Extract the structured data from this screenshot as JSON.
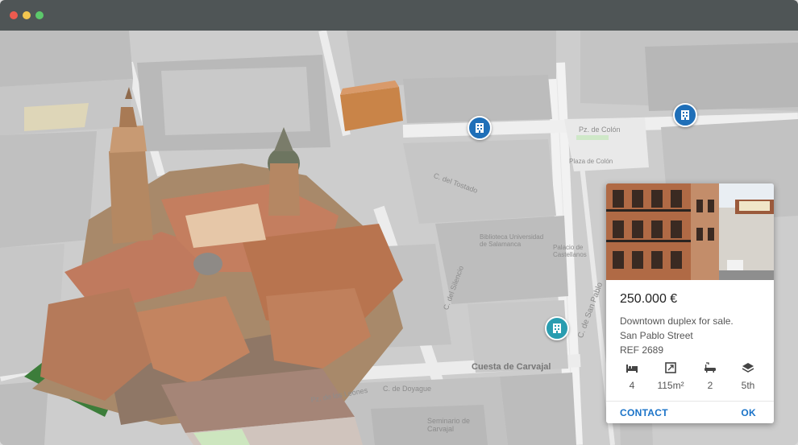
{
  "map": {
    "labels": {
      "plaza_colon": "Pz. de Colón",
      "plaza_colon_small": "Plaza de Colón",
      "calle_tostado": "C. del Tostado",
      "c_san_pablo": "C. de San Pablo",
      "cuesta_carvajal": "Cuesta de Carvajal",
      "pz_leones": "Pz. de los Leones",
      "c_doyague": "C. de Doyague",
      "seminario": "Seminario de Carvajal",
      "biblioteca": "Biblioteca Universidad de Salamanca",
      "palacio": "Palacio de Castellanos",
      "c_silencio": "C. del Silencio"
    },
    "pins": [
      {
        "name": "property-pin-1",
        "type": "building-icon"
      },
      {
        "name": "property-pin-2",
        "type": "building-icon"
      },
      {
        "name": "property-pin-3",
        "type": "building-icon"
      }
    ]
  },
  "listing": {
    "price": "250.000 €",
    "description": "Downtown duplex for sale.",
    "street": "San Pablo Street",
    "ref": "REF 2689",
    "stats": {
      "bedrooms": "4",
      "area": "115m²",
      "bathrooms": "2",
      "floor": "5th"
    },
    "contact_label": "CONTACT",
    "ok_label": "OK"
  },
  "colors": {
    "titlebar": "#4f5556",
    "pin_blue": "#1f6fb8",
    "pin_teal": "#2a9db0",
    "accent": "#1a73c8"
  }
}
